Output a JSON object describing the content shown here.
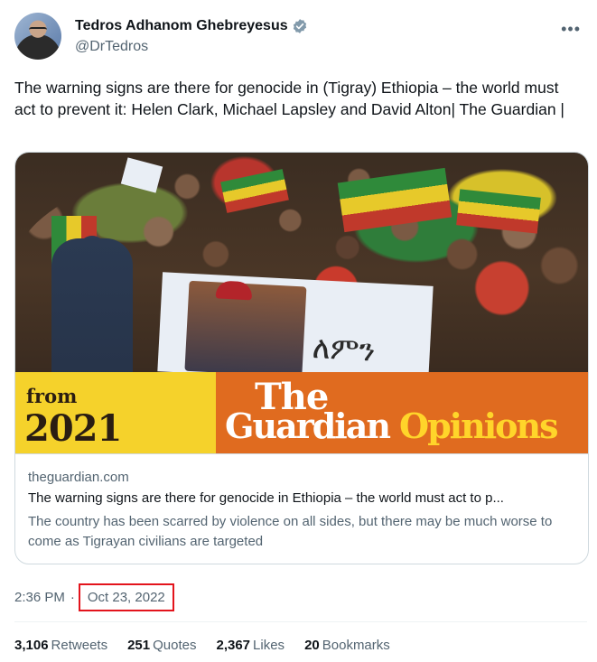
{
  "author": {
    "display_name": "Tedros Adhanom Ghebreyesus",
    "handle": "@DrTedros",
    "verified": true
  },
  "tweet": {
    "text": "The warning signs are there for genocide in (Tigray) Ethiopia – the world must act to prevent it: Helen Clark, Michael Lapsley and David Alton| The Guardian |"
  },
  "card": {
    "image_overlay": {
      "from": "from",
      "year": "2021",
      "the": "The",
      "guardian": "Guardian",
      "opinions": "Opinions",
      "banner_script": "ለምን"
    },
    "domain": "theguardian.com",
    "title": "The warning signs are there for genocide in Ethiopia – the world must act to p...",
    "description": "The country has been scarred by violence on all sides, but there may be much worse to come as Tigrayan civilians are targeted"
  },
  "meta": {
    "time": "2:36 PM",
    "separator": "·",
    "date": "Oct 23, 2022"
  },
  "stats": [
    {
      "value": "3,106",
      "label": "Retweets"
    },
    {
      "value": "251",
      "label": "Quotes"
    },
    {
      "value": "2,367",
      "label": "Likes"
    },
    {
      "value": "20",
      "label": "Bookmarks"
    }
  ],
  "colors": {
    "verified": "#829aab",
    "date_highlight": "#e3141c",
    "guardian_orange": "#e06b1f",
    "opinions_yellow": "#ffd52a"
  },
  "icons": {
    "more": "more-options-icon",
    "verified": "verified-badge-icon"
  }
}
